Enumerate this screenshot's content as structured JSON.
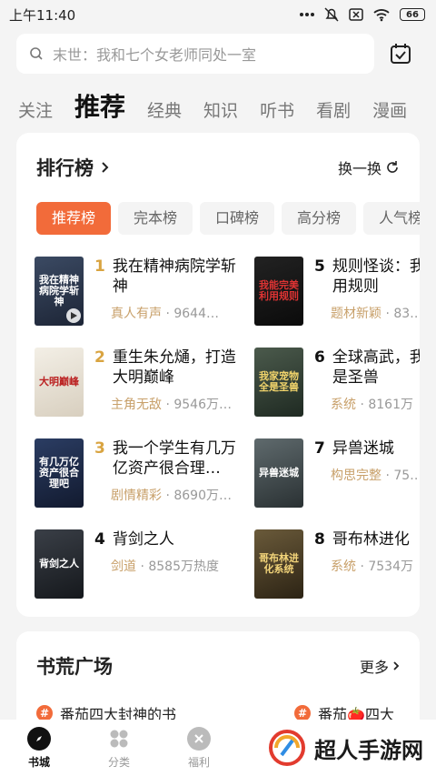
{
  "status_bar": {
    "time": "上午11:40",
    "battery": "66"
  },
  "search": {
    "placeholder": "末世：我和七个女老师同处一室"
  },
  "tabs": [
    {
      "label": "关注"
    },
    {
      "label": "推荐"
    },
    {
      "label": "经典"
    },
    {
      "label": "知识"
    },
    {
      "label": "听书"
    },
    {
      "label": "看剧"
    },
    {
      "label": "漫画"
    }
  ],
  "ranking": {
    "title": "排行榜",
    "switch_label": "换一换",
    "chips": [
      "推荐榜",
      "完本榜",
      "口碑榜",
      "高分榜",
      "人气榜"
    ],
    "books": [
      {
        "rank": "1",
        "title": "我在精神病院学斩神",
        "tag": "真人有声",
        "heat": "· 9644…",
        "cover_text": "我在精神病院学斩神"
      },
      {
        "rank": "5",
        "title": "规则怪谈：我美利用规则",
        "tag": "题材新颖",
        "heat": "· 83…",
        "cover_text": "我能完美利用规则"
      },
      {
        "rank": "2",
        "title": "重生朱允熥，打造大明巅峰",
        "tag": "主角无敌",
        "heat": "· 9546万…",
        "cover_text": "大明巅峰"
      },
      {
        "rank": "6",
        "title": "全球高武，我物全是圣兽",
        "tag": "系统",
        "heat": "· 8161万",
        "cover_text": "我家宠物全是圣兽"
      },
      {
        "rank": "3",
        "title": "我一个学生有几万亿资产很合理…",
        "tag": "剧情精彩",
        "heat": "· 8690万…",
        "cover_text": "有几万亿资产很合理吧"
      },
      {
        "rank": "7",
        "title": "异兽迷城",
        "tag": "构思完整",
        "heat": "· 75…",
        "cover_text": "异兽迷城"
      },
      {
        "rank": "4",
        "title": "背剑之人",
        "tag": "剑道",
        "heat": "· 8585万热度",
        "cover_text": "背剑之人"
      },
      {
        "rank": "8",
        "title": "哥布林进化",
        "tag": "系统",
        "heat": "· 7534万",
        "cover_text": "哥布林进化系统"
      }
    ]
  },
  "square": {
    "title": "书荒广场",
    "more_label": "更多",
    "items": [
      {
        "label": "番茄四大封神的书"
      },
      {
        "label": "番茄🍅四大"
      }
    ]
  },
  "bottom_nav": [
    {
      "label": "书城"
    },
    {
      "label": "分类"
    },
    {
      "label": "福利"
    }
  ],
  "watermark": {
    "text": "超人手游网"
  },
  "colors": {
    "accent": "#f26b3a",
    "gold_rank": "#d9a441",
    "tag": "#c8a06a"
  }
}
